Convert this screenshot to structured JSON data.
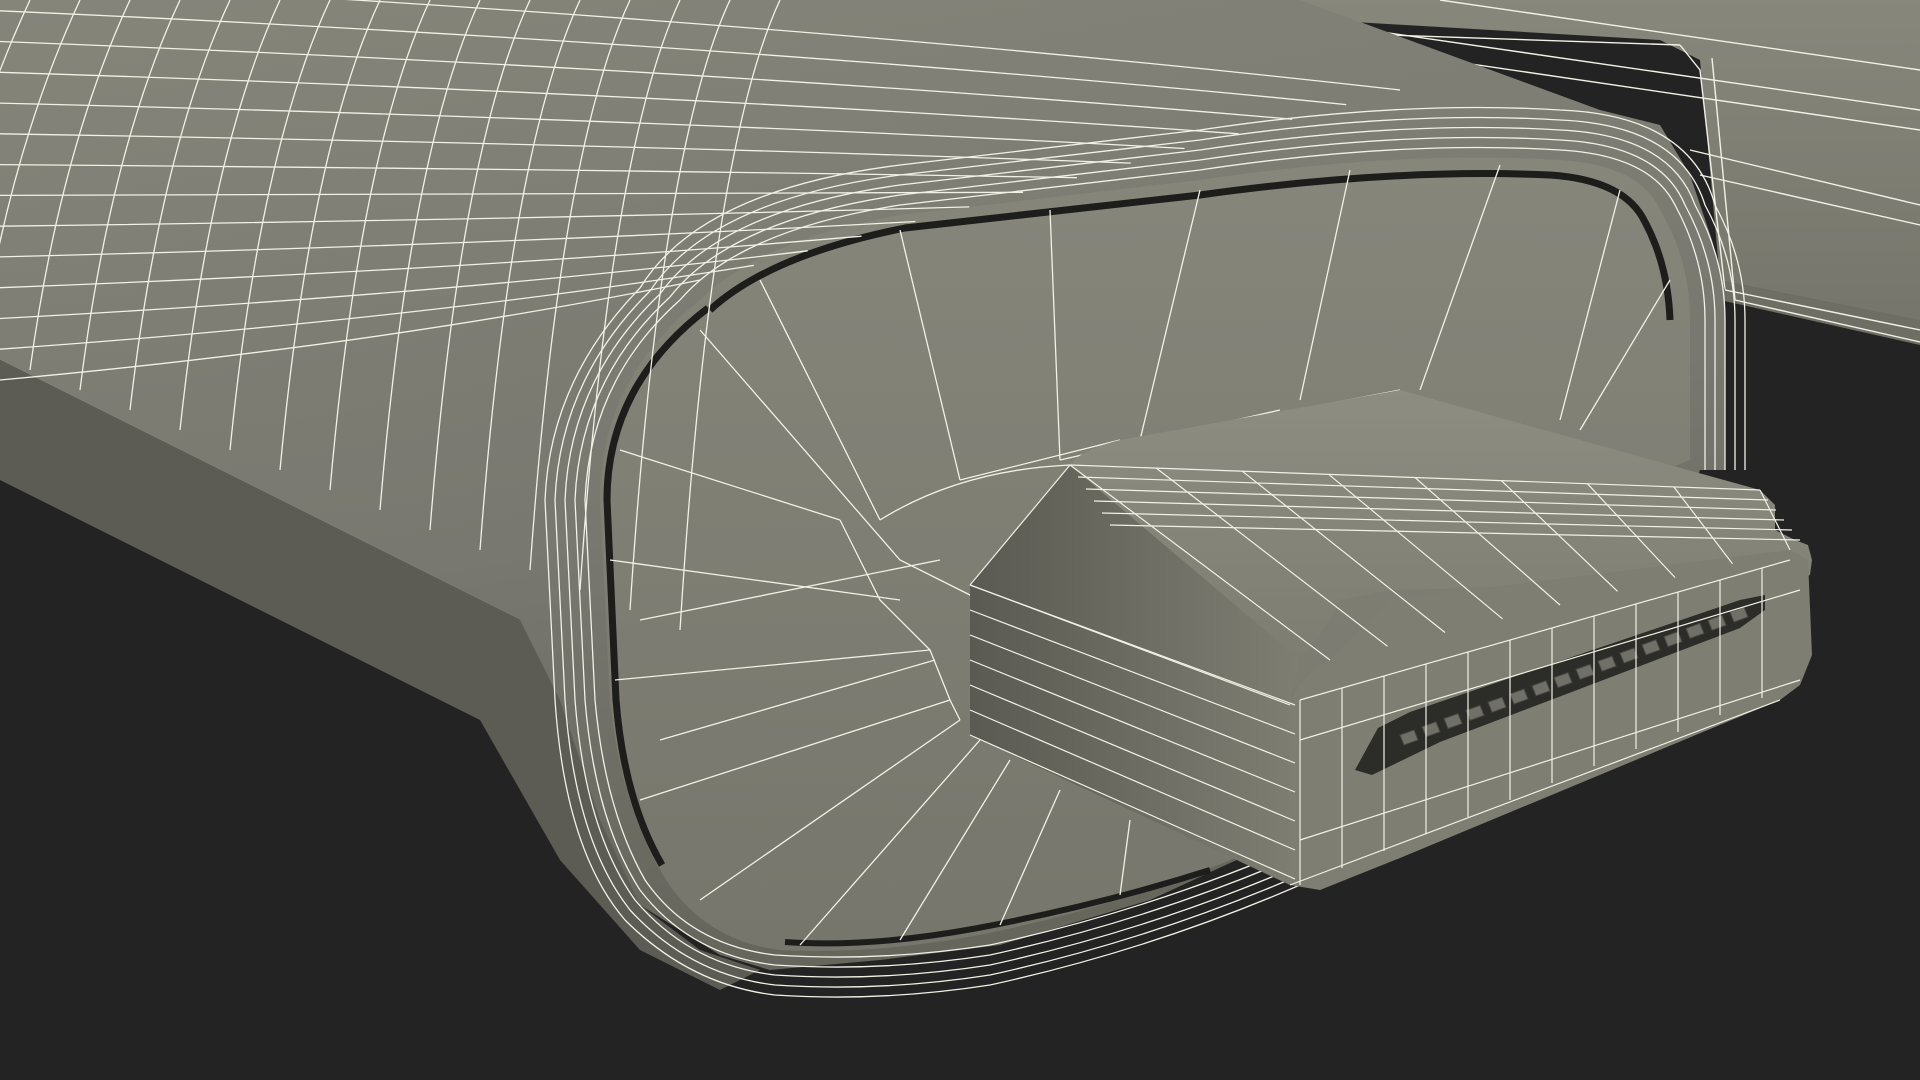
{
  "scene": {
    "subject": "mini-hdmi-connector-wireframe-render",
    "colors": {
      "background": "#232323",
      "body_fill": "#7c7c70",
      "body_shadow": "#5f5f56",
      "face_fill": "#808074",
      "plug_fill": "#85857a",
      "plug_shadow": "#66665d",
      "socket_dark": "#2c2c29",
      "pin_fill": "#6c6c64",
      "wire": "#f2f1e6",
      "seam_dark": "#1d1d1b"
    }
  }
}
